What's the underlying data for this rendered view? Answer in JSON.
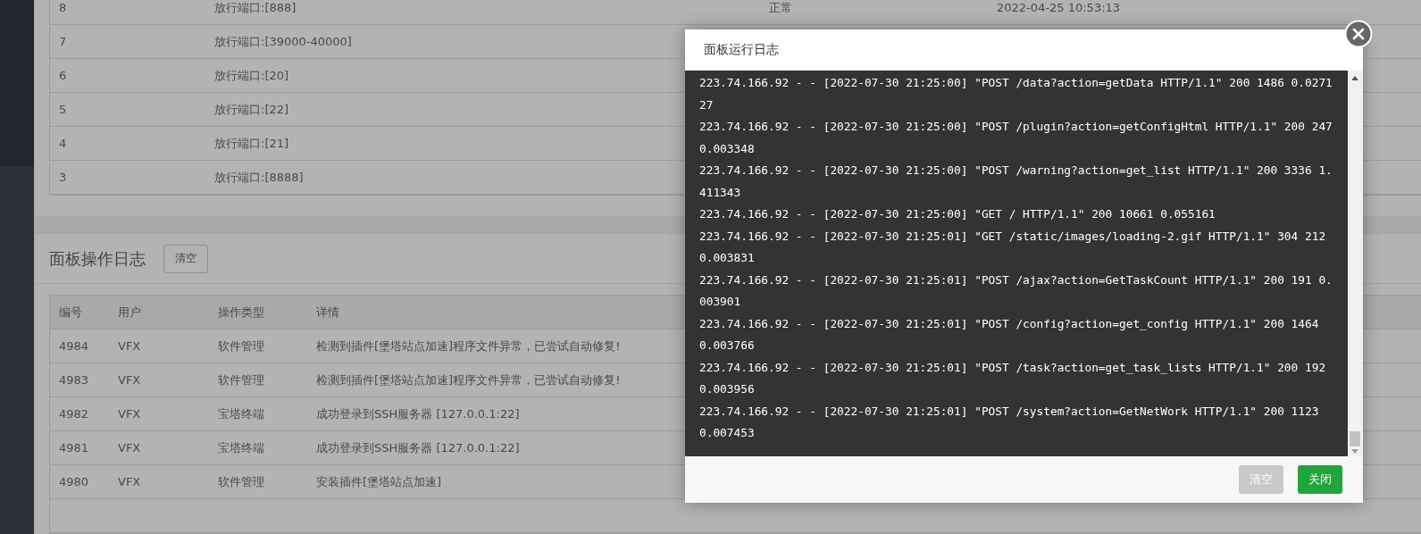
{
  "firewall_table": {
    "rows": [
      {
        "id": "8",
        "detail": "放行端口:[888]",
        "status": "正常",
        "time": "2022-04-25 10:53:13"
      },
      {
        "id": "7",
        "detail": "放行端口:[39000-40000]"
      },
      {
        "id": "6",
        "detail": "放行端口:[20]"
      },
      {
        "id": "5",
        "detail": "放行端口:[22]"
      },
      {
        "id": "4",
        "detail": "放行端口:[21]"
      },
      {
        "id": "3",
        "detail": "放行端口:[8888]"
      }
    ]
  },
  "operation_log": {
    "title": "面板操作日志",
    "clear_button": "清空",
    "columns": [
      "编号",
      "用户",
      "操作类型",
      "详情"
    ],
    "rows": [
      {
        "id": "4984",
        "user": "VFX",
        "type": "软件管理",
        "detail": "检测到插件[堡塔站点加速]程序文件异常，已尝试自动修复!"
      },
      {
        "id": "4983",
        "user": "VFX",
        "type": "软件管理",
        "detail": "检测到插件[堡塔站点加速]程序文件异常，已尝试自动修复!"
      },
      {
        "id": "4982",
        "user": "VFX",
        "type": "宝塔终端",
        "detail": "成功登录到SSH服务器 [127.0.0.1:22]"
      },
      {
        "id": "4981",
        "user": "VFX",
        "type": "宝塔终端",
        "detail": "成功登录到SSH服务器 [127.0.0.1:22]"
      },
      {
        "id": "4980",
        "user": "VFX",
        "type": "软件管理",
        "detail": "安装插件[堡塔站点加速]"
      }
    ]
  },
  "modal": {
    "title": "面板运行日志",
    "log_lines": [
      "223.74.166.92 - - [2022-07-30 21:25:00] \"POST /data?action=getData HTTP/1.1\" 200 1486 0.027127",
      "223.74.166.92 - - [2022-07-30 21:25:00] \"POST /plugin?action=getConfigHtml HTTP/1.1\" 200 247 0.003348",
      "223.74.166.92 - - [2022-07-30 21:25:00] \"POST /warning?action=get_list HTTP/1.1\" 200 3336 1.411343",
      "223.74.166.92 - - [2022-07-30 21:25:00] \"GET / HTTP/1.1\" 200 10661 0.055161",
      "223.74.166.92 - - [2022-07-30 21:25:01] \"GET /static/images/loading-2.gif HTTP/1.1\" 304 212 0.003831",
      "223.74.166.92 - - [2022-07-30 21:25:01] \"POST /ajax?action=GetTaskCount HTTP/1.1\" 200 191 0.003901",
      "223.74.166.92 - - [2022-07-30 21:25:01] \"POST /config?action=get_config HTTP/1.1\" 200 1464 0.003766",
      "223.74.166.92 - - [2022-07-30 21:25:01] \"POST /task?action=get_task_lists HTTP/1.1\" 200 192 0.003956",
      "223.74.166.92 - - [2022-07-30 21:25:01] \"POST /system?action=GetNetWork HTTP/1.1\" 200 1123 0.007453"
    ],
    "buttons": [
      {
        "label": "清空",
        "kind": "secondary"
      },
      {
        "label": "关闭",
        "kind": "primary"
      }
    ]
  }
}
